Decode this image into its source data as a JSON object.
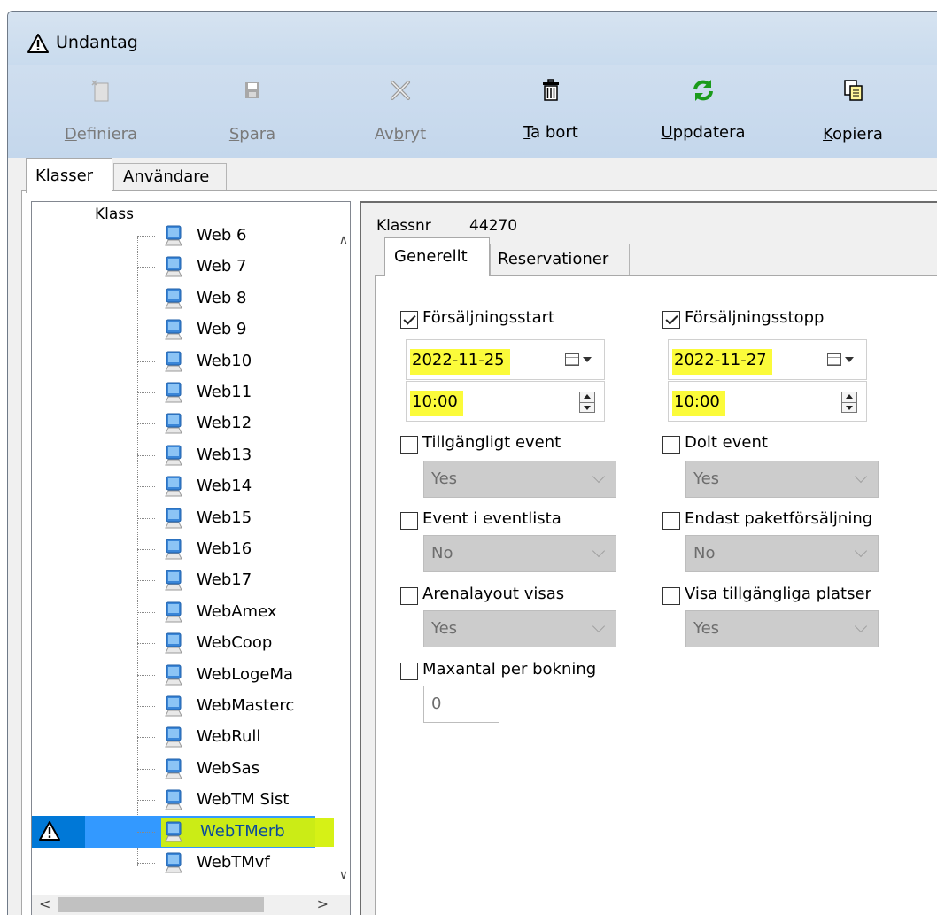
{
  "window": {
    "title": "Undantag"
  },
  "toolbar": [
    {
      "label": "Definiera",
      "mnemonic": "D",
      "rest": "efiniera",
      "enabled": false,
      "icon": "define-icon"
    },
    {
      "label": "Spara",
      "mnemonic": "S",
      "rest": "para",
      "enabled": false,
      "icon": "save-icon"
    },
    {
      "label": "Avbryt",
      "pre": "Av",
      "mnemonic": "b",
      "rest": "ryt",
      "enabled": false,
      "icon": "cancel-icon"
    },
    {
      "label": "Ta bort",
      "mnemonic": "T",
      "rest": "a bort",
      "enabled": true,
      "icon": "trash-icon"
    },
    {
      "label": "Uppdatera",
      "mnemonic": "U",
      "rest": "ppdatera",
      "enabled": true,
      "icon": "refresh-icon"
    },
    {
      "label": "Kopiera",
      "mnemonic": "K",
      "rest": "opiera",
      "enabled": true,
      "icon": "copy-icon"
    }
  ],
  "main_tabs": {
    "klasser": "Klasser",
    "anvandare": "Användare"
  },
  "tree": {
    "header": "Klass",
    "items": [
      "Web 6",
      "Web 7",
      "Web 8",
      "Web 9",
      "Web10",
      "Web11",
      "Web12",
      "Web13",
      "Web14",
      "Web15",
      "Web16",
      "Web17",
      "WebAmex",
      "WebCoop",
      "WebLogeMa",
      "WebMasterc",
      "WebRull",
      "WebSas",
      "WebTM Sist",
      "WebTMerb",
      "WebTMvf"
    ],
    "selected": "WebTMerb"
  },
  "detail": {
    "klassnr_label": "Klassnr",
    "klassnr_value": "44270",
    "tabs": {
      "generellt": "Generellt",
      "reservationer": "Reservationer"
    },
    "forsaljningsstart": {
      "label": "Försäljningsstart",
      "checked": true,
      "date": "2022-11-25",
      "time": "10:00"
    },
    "forsaljningsstopp": {
      "label": "Försäljningsstopp",
      "checked": true,
      "date": "2022-11-27",
      "time": "10:00"
    },
    "tillgangligt_event": {
      "label": "Tillgängligt event",
      "checked": false,
      "value": "Yes"
    },
    "dolt_event": {
      "label": "Dolt event",
      "checked": false,
      "value": "Yes"
    },
    "event_i_eventlista": {
      "label": "Event i eventlista",
      "checked": false,
      "value": "No"
    },
    "endast_paketforsaljning": {
      "label": "Endast paketförsäljning",
      "checked": false,
      "value": "No"
    },
    "arenalayout_visas": {
      "label": "Arenalayout visas",
      "checked": false,
      "value": "Yes"
    },
    "visa_tillgangliga_platser": {
      "label": "Visa tillgängliga platser",
      "checked": false,
      "value": "Yes"
    },
    "maxantal_per_bokning": {
      "label": "Maxantal per bokning",
      "checked": false,
      "value": "0"
    }
  },
  "colors": {
    "highlight": "#fbfb3a",
    "selection": "#3399ff",
    "titlebar": "#cfdeef"
  }
}
